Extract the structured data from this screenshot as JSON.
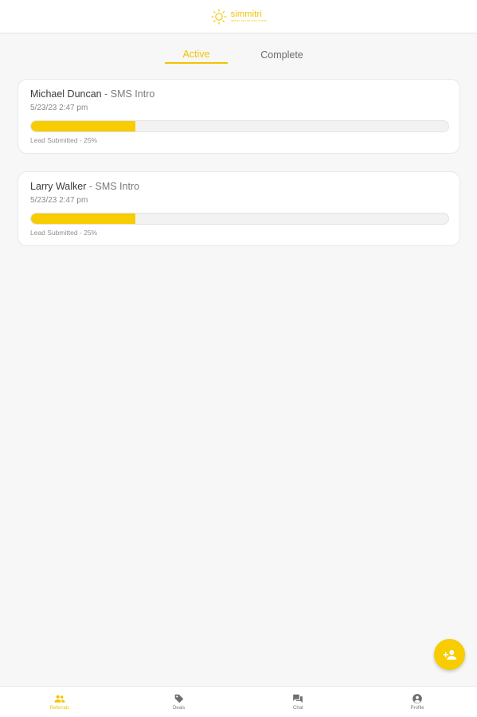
{
  "header": {
    "logo_text": "simmitri",
    "logo_subtext": "SMART SOLAR SOLUTIONS"
  },
  "tabs": [
    {
      "label": "Active",
      "selected": true
    },
    {
      "label": "Complete",
      "selected": false
    }
  ],
  "referrals": [
    {
      "name": "Michael Duncan",
      "separator": " - ",
      "campaign": "SMS Intro",
      "date": "5/23/23 2:47 pm",
      "progress": 0.25,
      "status": "Lead Submitted - 25%"
    },
    {
      "name": "Larry Walker",
      "separator": " - ",
      "campaign": "SMS Intro",
      "date": "5/23/23 2:47 pm",
      "progress": 0.25,
      "status": "Lead Submitted - 25%"
    }
  ],
  "fab": {
    "icon": "add-person-icon"
  },
  "bottom_nav": [
    {
      "label": "Referrals",
      "icon": "people-icon",
      "active": true
    },
    {
      "label": "Deals",
      "icon": "tag-icon",
      "active": false
    },
    {
      "label": "Chat",
      "icon": "chat-icon",
      "active": false
    },
    {
      "label": "Profile",
      "icon": "profile-icon",
      "active": false
    }
  ],
  "colors": {
    "accent": "#f7cc00",
    "accent_text": "#f2c300",
    "background": "#f7f7f7"
  }
}
